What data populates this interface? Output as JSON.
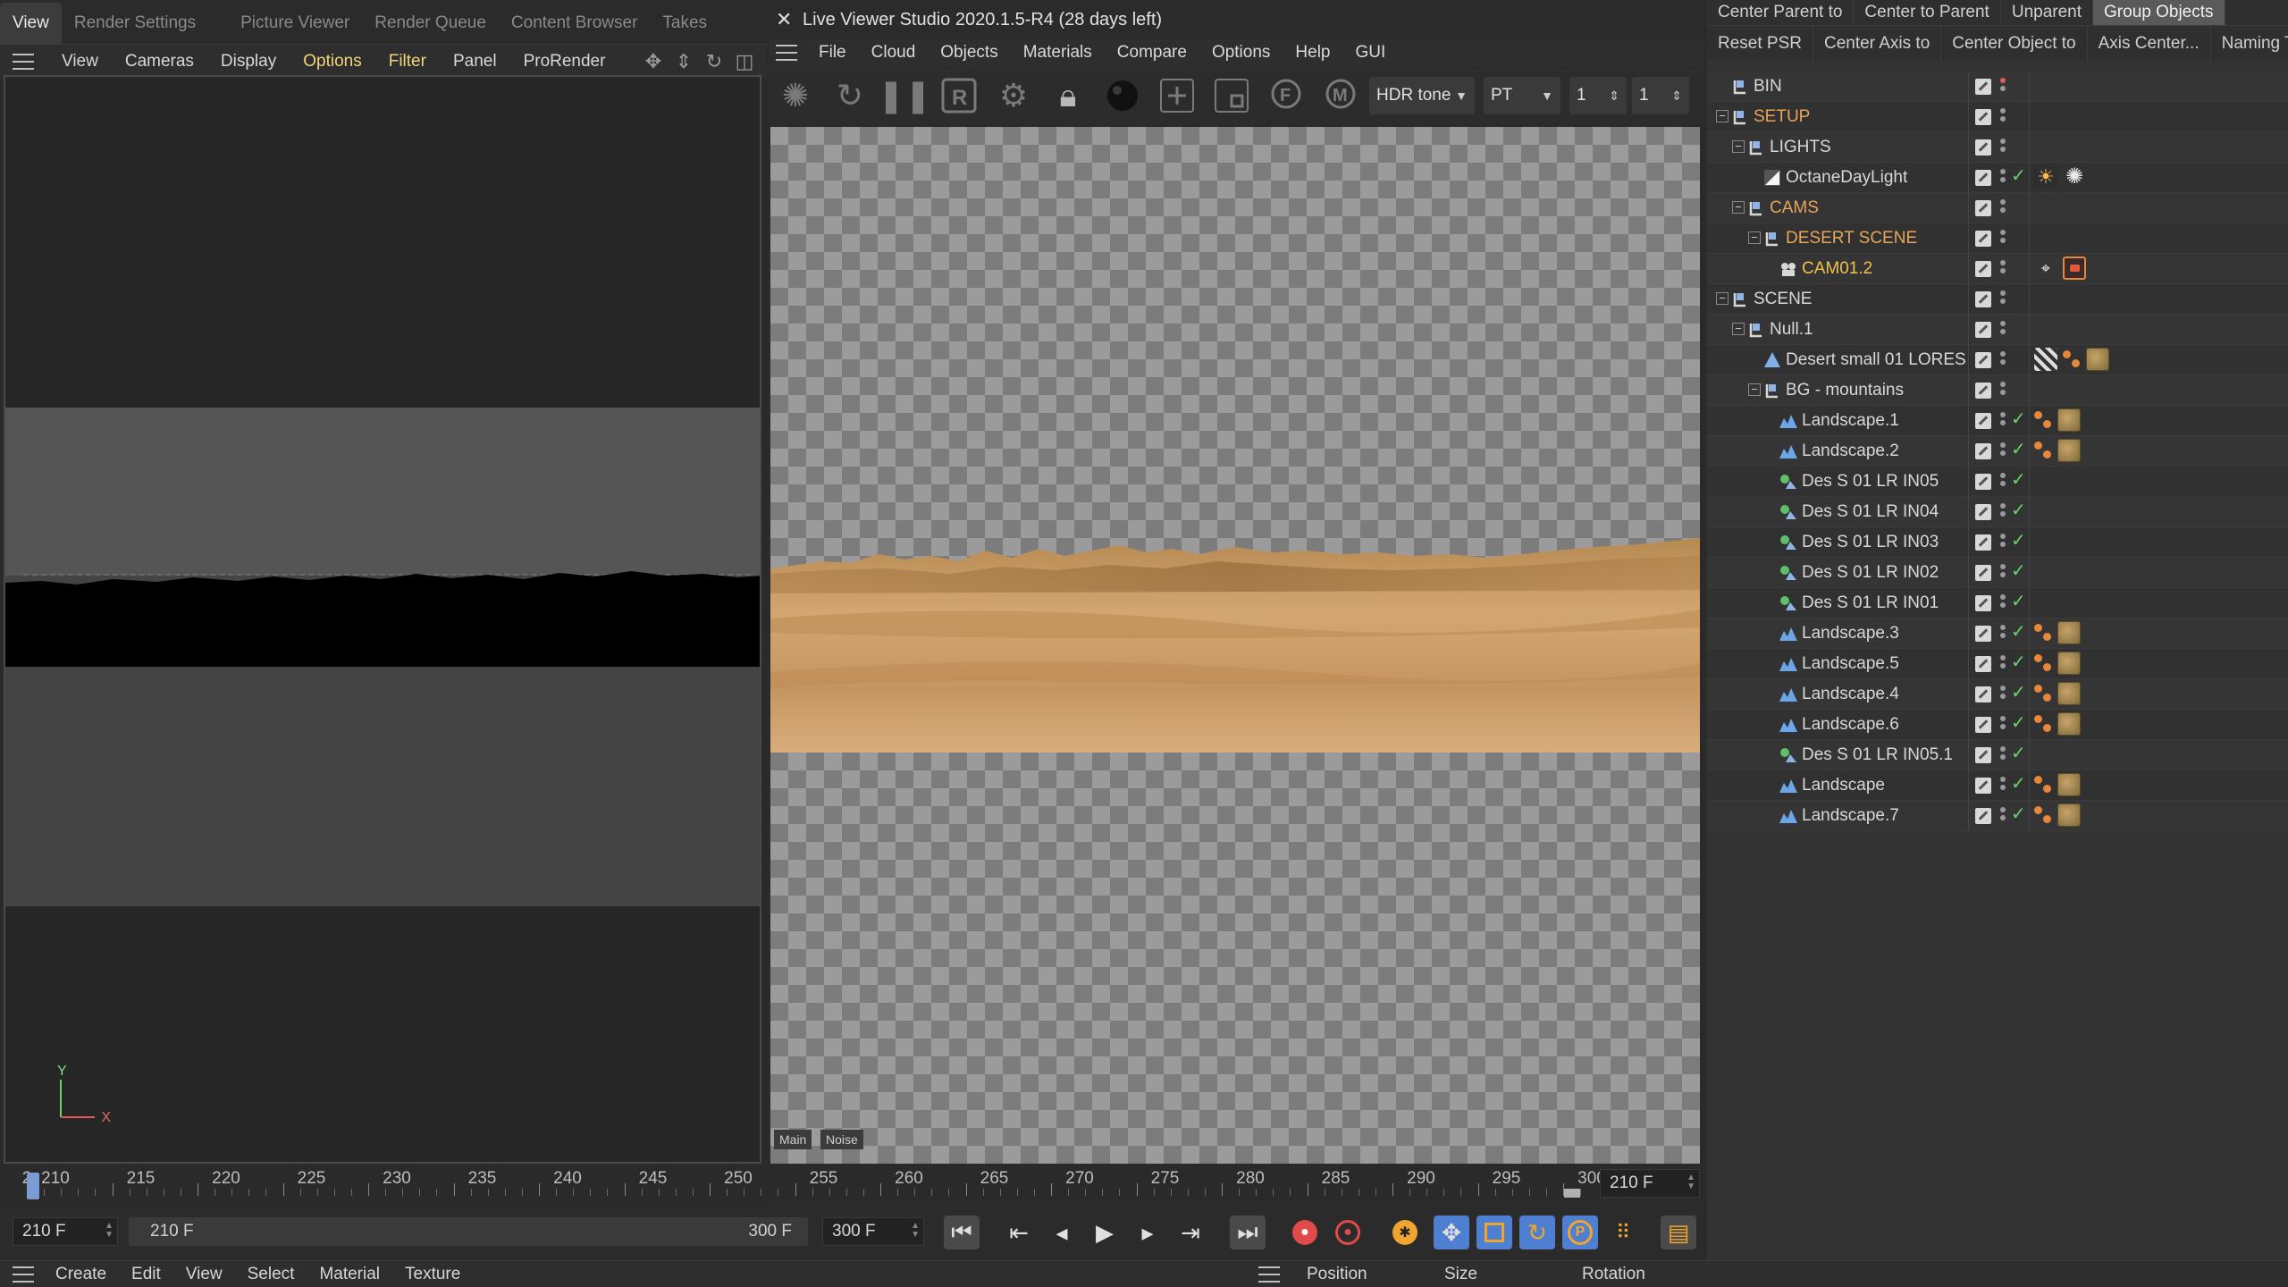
{
  "left": {
    "tabs": [
      "View",
      "Render Settings",
      "Picture Viewer",
      "Render Queue",
      "Content Browser",
      "Takes"
    ],
    "menu": [
      "View",
      "Cameras",
      "Display",
      "Options",
      "Filter",
      "Panel",
      "ProRender"
    ],
    "axis": {
      "y": "Y",
      "x": "X"
    }
  },
  "viewer": {
    "title": "Live Viewer Studio 2020.1.5-R4 (28 days left)",
    "menu": [
      "File",
      "Cloud",
      "Objects",
      "Materials",
      "Compare",
      "Options",
      "Help",
      "GUI"
    ],
    "tone_select": "HDR tone",
    "mode_select": "PT",
    "field1": "1",
    "field2": "1",
    "tags": [
      "Main",
      "Noise"
    ]
  },
  "timeline": {
    "labels": [
      "2",
      "210",
      "215",
      "220",
      "225",
      "230",
      "235",
      "240",
      "245",
      "250",
      "255",
      "260",
      "265",
      "270",
      "275",
      "280",
      "285",
      "290",
      "295",
      "300"
    ],
    "current_frame": "210 F",
    "start_field": "210 F",
    "range_start": "210 F",
    "range_end": "300 F",
    "end_field": "300 F"
  },
  "bottom": {
    "menu": [
      "Create",
      "Edit",
      "View",
      "Select",
      "Material",
      "Texture"
    ],
    "attr": [
      "Position",
      "Size",
      "Rotation"
    ]
  },
  "right": {
    "cmd1": [
      "Center Parent to",
      "Center to Parent",
      "Unparent",
      "Group Objects"
    ],
    "cmd2": [
      "Reset PSR",
      "Center Axis to",
      "Center Object to",
      "Axis Center...",
      "Naming T"
    ],
    "objects": [
      {
        "name": "BIN",
        "level": 0,
        "icon": "null",
        "twist": "",
        "color": "normal",
        "dots": "red",
        "check": false,
        "tags": []
      },
      {
        "name": "SETUP",
        "level": 0,
        "icon": "null",
        "twist": "-",
        "color": "orange",
        "dots": "gray",
        "check": false,
        "tags": []
      },
      {
        "name": "LIGHTS",
        "level": 1,
        "icon": "null",
        "twist": "-",
        "color": "normal",
        "dots": "gray",
        "check": false,
        "tags": []
      },
      {
        "name": "OctaneDayLight",
        "level": 2,
        "icon": "light",
        "twist": "",
        "color": "normal",
        "dots": "gray",
        "check": true,
        "tags": [
          "sun",
          "gear"
        ]
      },
      {
        "name": "CAMS",
        "level": 1,
        "icon": "null",
        "twist": "-",
        "color": "orange",
        "dots": "gray",
        "check": false,
        "tags": []
      },
      {
        "name": "DESERT SCENE",
        "level": 2,
        "icon": "null",
        "twist": "-",
        "color": "orange",
        "dots": "gray",
        "check": false,
        "tags": []
      },
      {
        "name": "CAM01.2",
        "level": 3,
        "icon": "camera",
        "twist": "",
        "color": "gold",
        "dots": "gray",
        "check": false,
        "tags": [
          "target",
          "camtag"
        ]
      },
      {
        "name": "SCENE",
        "level": 0,
        "icon": "null",
        "twist": "-",
        "color": "normal",
        "dots": "gray",
        "check": false,
        "tags": []
      },
      {
        "name": "Null.1",
        "level": 1,
        "icon": "null",
        "twist": "-",
        "color": "normal",
        "dots": "gray",
        "check": false,
        "tags": []
      },
      {
        "name": "Desert small 01 LORES",
        "level": 2,
        "icon": "poly",
        "twist": "",
        "color": "normal",
        "dots": "gray",
        "check": false,
        "tags": [
          "checker",
          "oct",
          "mat"
        ]
      },
      {
        "name": "BG - mountains",
        "level": 2,
        "icon": "null",
        "twist": "-",
        "color": "normal",
        "dots": "gray",
        "check": false,
        "tags": []
      },
      {
        "name": "Landscape.1",
        "level": 3,
        "icon": "landscape",
        "twist": "",
        "color": "normal",
        "dots": "gray",
        "check": true,
        "tags": [
          "oct",
          "mat"
        ]
      },
      {
        "name": "Landscape.2",
        "level": 3,
        "icon": "landscape",
        "twist": "",
        "color": "normal",
        "dots": "gray",
        "check": true,
        "tags": [
          "oct",
          "mat"
        ]
      },
      {
        "name": "Des S 01 LR IN05",
        "level": 3,
        "icon": "instance",
        "twist": "",
        "color": "normal",
        "dots": "gray",
        "check": true,
        "tags": []
      },
      {
        "name": "Des S 01 LR IN04",
        "level": 3,
        "icon": "instance",
        "twist": "",
        "color": "normal",
        "dots": "gray",
        "check": true,
        "tags": []
      },
      {
        "name": "Des S 01 LR IN03",
        "level": 3,
        "icon": "instance",
        "twist": "",
        "color": "normal",
        "dots": "gray",
        "check": true,
        "tags": []
      },
      {
        "name": "Des S 01 LR IN02",
        "level": 3,
        "icon": "instance",
        "twist": "",
        "color": "normal",
        "dots": "gray",
        "check": true,
        "tags": []
      },
      {
        "name": "Des S 01 LR IN01",
        "level": 3,
        "icon": "instance",
        "twist": "",
        "color": "normal",
        "dots": "gray",
        "check": true,
        "tags": []
      },
      {
        "name": "Landscape.3",
        "level": 3,
        "icon": "landscape",
        "twist": "",
        "color": "normal",
        "dots": "gray",
        "check": true,
        "tags": [
          "oct",
          "mat"
        ]
      },
      {
        "name": "Landscape.5",
        "level": 3,
        "icon": "landscape",
        "twist": "",
        "color": "normal",
        "dots": "gray",
        "check": true,
        "tags": [
          "oct",
          "mat"
        ]
      },
      {
        "name": "Landscape.4",
        "level": 3,
        "icon": "landscape",
        "twist": "",
        "color": "normal",
        "dots": "gray",
        "check": true,
        "tags": [
          "oct",
          "mat"
        ]
      },
      {
        "name": "Landscape.6",
        "level": 3,
        "icon": "landscape",
        "twist": "",
        "color": "normal",
        "dots": "gray",
        "check": true,
        "tags": [
          "oct",
          "mat"
        ]
      },
      {
        "name": "Des S 01 LR IN05.1",
        "level": 3,
        "icon": "instance",
        "twist": "",
        "color": "normal",
        "dots": "gray",
        "check": true,
        "tags": []
      },
      {
        "name": "Landscape",
        "level": 3,
        "icon": "landscape",
        "twist": "",
        "color": "normal",
        "dots": "gray",
        "check": true,
        "tags": [
          "oct",
          "mat"
        ]
      },
      {
        "name": "Landscape.7",
        "level": 3,
        "icon": "landscape",
        "twist": "",
        "color": "normal",
        "dots": "gray",
        "check": true,
        "tags": [
          "oct",
          "mat"
        ]
      }
    ]
  },
  "colors": {
    "accent_yellow": "#f1d57a",
    "orange_label": "#e8a45a",
    "gold_label": "#f0c24a",
    "active_blue": "#4f7fd0"
  }
}
